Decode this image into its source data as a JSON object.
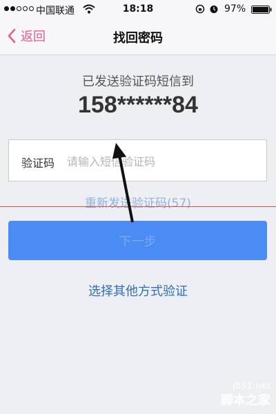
{
  "status_bar": {
    "carrier": "中国联通",
    "time": "18:18",
    "battery": "97%"
  },
  "nav": {
    "back_label": "返回",
    "title": "找回密码"
  },
  "main": {
    "sent_label": "已发送验证码短信到",
    "phone": "158******84",
    "code_label": "验证码",
    "code_placeholder": "请输入短信验证码",
    "code_value": "",
    "resend_label": "重新发送验证码(57)",
    "next_label": "下一步",
    "other_label": "选择其他方式验证"
  },
  "colors": {
    "accent_pink": "#e85a89",
    "button_blue": "#4a8cf3",
    "link_blue": "#2f6eb6"
  },
  "watermark": {
    "url": "jb51.net",
    "name": "脚本之家"
  }
}
